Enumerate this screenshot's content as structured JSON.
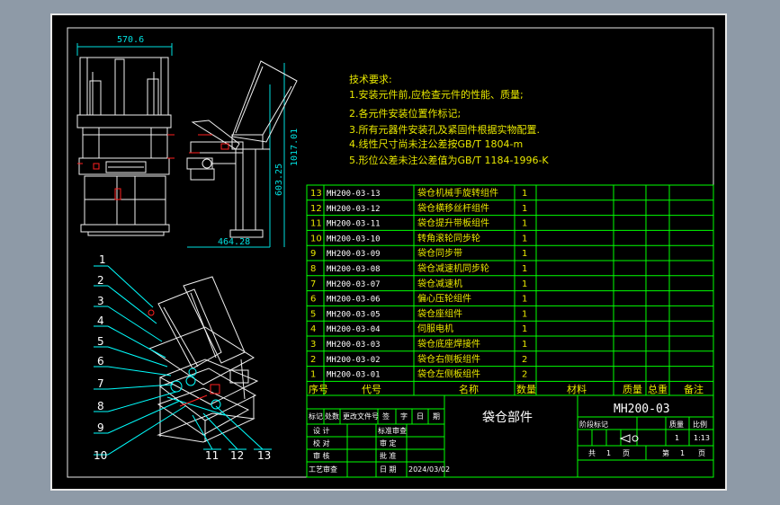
{
  "colors": {
    "frame": "#e8e8e8",
    "table": "#00ff00",
    "text_yellow": "#e8e800",
    "text_white": "#ffffff",
    "text_cyan": "#00ffff",
    "dim_cyan": "#00e0e0",
    "drawing_white": "#f0f0f0",
    "drawing_red": "#ff2020"
  },
  "dimensions": {
    "top_width": "570.6",
    "bottom_width": "464.28",
    "height_total": "1017.01",
    "height_side": "603.25"
  },
  "requirements": {
    "title": "技术要求:",
    "lines": [
      "1.安装元件前,应检查元件的性能、质量;",
      "2.各元件安装位置作标记;",
      "3.所有元器件安装孔及紧固件根据实物配置.",
      "4.线性尺寸尚未注公差按GB/T 1804-m",
      "5.形位公差未注公差值为GB/T 1184-1996-K"
    ]
  },
  "parts": [
    {
      "no": "13",
      "code": "MH200-03-13",
      "name": "袋仓机械手旋转组件",
      "qty": "1"
    },
    {
      "no": "12",
      "code": "MH200-03-12",
      "name": "袋仓横移丝杆组件",
      "qty": "1"
    },
    {
      "no": "11",
      "code": "MH200-03-11",
      "name": "袋仓提升带板组件",
      "qty": "1"
    },
    {
      "no": "10",
      "code": "MH200-03-10",
      "name": "转角滚轮同步轮",
      "qty": "1"
    },
    {
      "no": "9",
      "code": "MH200-03-09",
      "name": "袋仓同步带",
      "qty": "1"
    },
    {
      "no": "8",
      "code": "MH200-03-08",
      "name": "袋仓减速机同步轮",
      "qty": "1"
    },
    {
      "no": "7",
      "code": "MH200-03-07",
      "name": "袋仓减速机",
      "qty": "1"
    },
    {
      "no": "6",
      "code": "MH200-03-06",
      "name": "偏心压轮组件",
      "qty": "1"
    },
    {
      "no": "5",
      "code": "MH200-03-05",
      "name": "袋仓座组件",
      "qty": "1"
    },
    {
      "no": "4",
      "code": "MH200-03-04",
      "name": "伺服电机",
      "qty": "1"
    },
    {
      "no": "3",
      "code": "MH200-03-03",
      "name": "袋仓底座焊接件",
      "qty": "1"
    },
    {
      "no": "2",
      "code": "MH200-03-02",
      "name": "袋仓右侧板组件",
      "qty": "2"
    },
    {
      "no": "1",
      "code": "MH200-03-01",
      "name": "袋仓左侧板组件",
      "qty": "2"
    }
  ],
  "table_header": {
    "no": "序号",
    "code": "代号",
    "name": "名称",
    "qty": "数量",
    "material": "材料",
    "unit_weight": "质量",
    "total_weight": "总重",
    "remark": "备注"
  },
  "title_block": {
    "drawing_name": "袋仓部件",
    "drawing_no": "MH200-03",
    "rev_cols": [
      "标记",
      "处数",
      "更改文件号",
      "签",
      "字",
      "日",
      "期"
    ],
    "rows_left": [
      "设 计",
      "校 对",
      "审 核",
      "工艺审查"
    ],
    "rows_mid": [
      "标准审查",
      "审 定",
      "批 准",
      "日 期"
    ],
    "date": "2024/03/02",
    "stage_labels": [
      "阶段标记",
      "质量",
      "比例"
    ],
    "scale": "1:13",
    "weight": "1",
    "sheet_total_label": "共",
    "sheet_total": "1",
    "sheet_page_label": "页",
    "sheet_no_label": "第",
    "sheet_no": "1"
  },
  "balloons": [
    "1",
    "2",
    "3",
    "4",
    "5",
    "6",
    "7",
    "8",
    "9",
    "10",
    "11",
    "12",
    "13"
  ]
}
